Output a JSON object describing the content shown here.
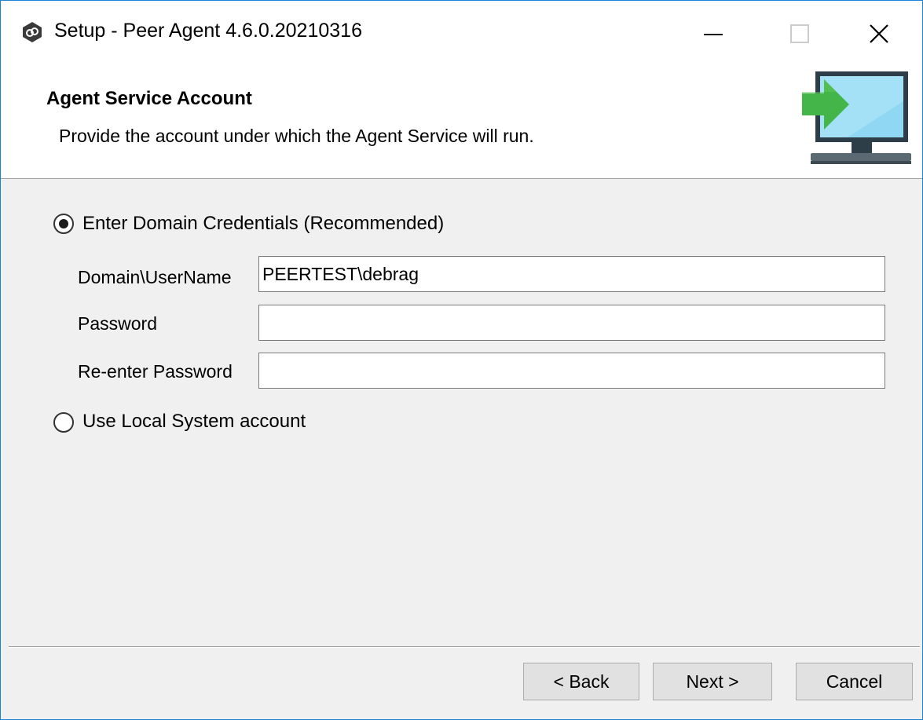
{
  "window": {
    "title": "Setup - Peer Agent 4.6.0.20210316",
    "controls": {
      "minimize_icon": "minimize-icon",
      "maximize_icon": "maximize-icon",
      "close_icon": "close-icon"
    }
  },
  "header": {
    "title": "Agent Service Account",
    "subtitle": "Provide the account under which the Agent Service will run.",
    "icon": "monitor-arrow-icon"
  },
  "options": {
    "domain": {
      "label": "Enter Domain Credentials (Recommended)",
      "selected": true
    },
    "local": {
      "label": "Use Local System account",
      "selected": false
    }
  },
  "fields": {
    "username": {
      "label": "Domain\\UserName",
      "value": "PEERTEST\\debrag"
    },
    "password": {
      "label": "Password",
      "value": ""
    },
    "reenter": {
      "label": "Re-enter Password",
      "value": ""
    }
  },
  "buttons": {
    "back": "< Back",
    "next": "Next >",
    "cancel": "Cancel"
  },
  "colors": {
    "window_border": "#1883d7",
    "arrow_green": "#3cb54a",
    "screen_blue": "#7fd0ee"
  }
}
